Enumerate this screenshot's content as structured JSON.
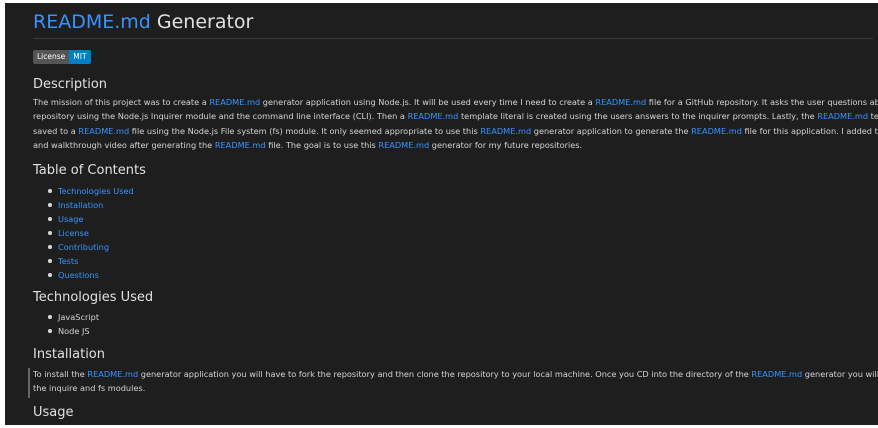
{
  "title": {
    "link": "README.md",
    "rest": " Generator"
  },
  "badge": {
    "label": "License",
    "value": "MIT"
  },
  "description": {
    "heading": "Description",
    "lines": [
      [
        {
          "t": "The mission of this project was to create a "
        },
        {
          "t": "README.md",
          "link": true
        },
        {
          "t": " generator application using Node.js. It will be used every time I need to create a "
        },
        {
          "t": "README.md",
          "link": true
        },
        {
          "t": " file for a GitHub repository. It asks the user questions about their"
        }
      ],
      [
        {
          "t": "repository using the Node.js Inquirer module and the command line interface (CLI). Then a "
        },
        {
          "t": "README.md",
          "link": true
        },
        {
          "t": " template literal is created using the users answers to the inquirer prompts. Lastly, the "
        },
        {
          "t": "README.md",
          "link": true
        },
        {
          "t": " template literal is"
        }
      ],
      [
        {
          "t": "saved to a "
        },
        {
          "t": "README.md",
          "link": true
        },
        {
          "t": " file using the Node.js File system (fs) module. It only seemed appropriate to use this "
        },
        {
          "t": "README.md",
          "link": true
        },
        {
          "t": " generator application to generate the "
        },
        {
          "t": "README.md",
          "link": true
        },
        {
          "t": " file for this application. I added the screenshot"
        }
      ],
      [
        {
          "t": "and walkthrough video after generating the "
        },
        {
          "t": "README.md",
          "link": true
        },
        {
          "t": " file. The goal is to use this "
        },
        {
          "t": "README.md",
          "link": true
        },
        {
          "t": " generator for my future repositories."
        }
      ]
    ]
  },
  "toc": {
    "heading": "Table of Contents",
    "items": [
      "Technologies Used",
      "Installation",
      "Usage",
      "License",
      "Contributing",
      "Tests",
      "Questions"
    ]
  },
  "technologies": {
    "heading": "Technologies Used",
    "items": [
      "JavaScript",
      "Node JS"
    ]
  },
  "installation": {
    "heading": "Installation",
    "lines": [
      [
        {
          "t": "To install the "
        },
        {
          "t": "README.md",
          "link": true
        },
        {
          "t": " generator application you will have to fork the repository and then clone the repository to your local machine. Once you CD into the directory of the "
        },
        {
          "t": "README.md",
          "link": true
        },
        {
          "t": " generator you will need to install"
        }
      ],
      [
        {
          "t": "the inquire and fs modules."
        }
      ]
    ]
  },
  "usage": {
    "heading": "Usage"
  }
}
